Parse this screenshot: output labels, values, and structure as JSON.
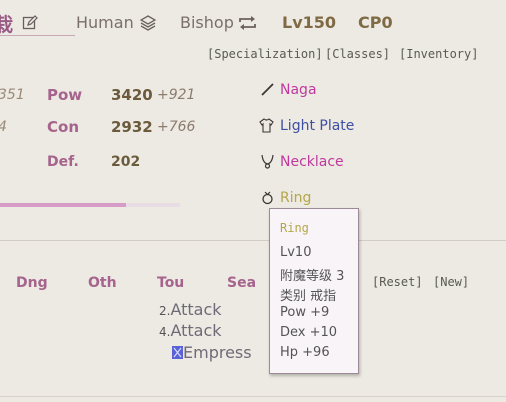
{
  "colors": {
    "accent": "#a5638d",
    "gold": "#6b5a3c",
    "magenta": "#c0399f",
    "blue": "#3e4ea3",
    "ring": "#b4a64a"
  },
  "header": {
    "name": "栽",
    "race": "Human",
    "class": "Bishop",
    "level": "Lv150",
    "cp": "CP0"
  },
  "top_links": [
    "[Specialization]",
    "[Classes]",
    "[Inventory]"
  ],
  "stats": [
    {
      "prev": "351",
      "label": "Pow",
      "value": "3420",
      "bonus": "+921"
    },
    {
      "prev": "4",
      "label": "Con",
      "value": "2932",
      "bonus": "+766"
    },
    {
      "label": "Def.",
      "value": "202"
    }
  ],
  "equipment": [
    {
      "icon": "wand-icon",
      "label": "Naga",
      "color": "#c0399f"
    },
    {
      "icon": "shirt-icon",
      "label": "Light Plate",
      "color": "#3e4ea3"
    },
    {
      "icon": "necklace-icon",
      "label": "Necklace",
      "color": "#c0399f"
    },
    {
      "icon": "ring-icon",
      "label": "Ring",
      "color": "#b4a64a"
    }
  ],
  "progress": {
    "fraction": 0.7
  },
  "action_columns": [
    "Dng",
    "Oth",
    "Tou",
    "Sea"
  ],
  "actions": [
    {
      "num": "2.",
      "text": "Attack"
    },
    {
      "num": "4.",
      "text": "Attack"
    },
    {
      "text": "Empress"
    }
  ],
  "action_buttons": [
    "[Reset]",
    "[New]"
  ],
  "tooltip": {
    "title": "Ring",
    "lines": [
      "Lv10",
      "附魔等级 3",
      "类别 戒指",
      "Pow +9",
      "Dex +10",
      "Hp +96"
    ]
  },
  "icons": [
    "edit-icon",
    "stack-icon",
    "swap-icon",
    "wand-icon",
    "shirt-icon",
    "necklace-icon",
    "ring-icon",
    "skill-icon"
  ]
}
